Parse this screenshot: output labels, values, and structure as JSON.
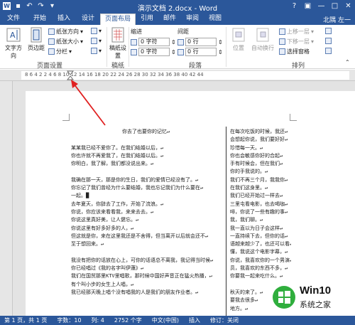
{
  "window": {
    "title": "演示文档 2.docx - Word",
    "user": "北隅 左一",
    "controls": [
      "?",
      "▣",
      "—",
      "□",
      "✕"
    ]
  },
  "tabs": [
    "文件",
    "开始",
    "插入",
    "设计",
    "页面布局",
    "引用",
    "邮件",
    "审阅",
    "视图"
  ],
  "active_tab": "页面布局",
  "ribbon": {
    "page_setup": {
      "label": "页面设置",
      "text_direction": "文字方向",
      "margins": "页边距",
      "orientation": "纸张方向",
      "size": "纸张大小",
      "columns": "分栏"
    },
    "manuscript": {
      "label": "稿纸",
      "settings": "稿纸设置"
    },
    "paragraph": {
      "label": "段落",
      "indent_label": "缩进",
      "spacing_label": "间距",
      "left_value": "0 字符",
      "right_value": "0 字符",
      "before_value": "0 行",
      "after_value": "0 行"
    },
    "arrange": {
      "label": "排列",
      "position": "位置",
      "wrap": "自动换行",
      "bring_forward": "上移一层",
      "send_backward": "下移一层",
      "selection_pane": "选择窗格"
    }
  },
  "ruler": {
    "ticks": "8  6  4  2     2  4  6  8  10  12  14  16  18  20  22  24  26  28  30  32  34  36  38  40  42  44"
  },
  "document": {
    "left_column": [
      "你去了也要你的记忆↵",
      "",
      "某某我已经不爱你了。在我们结婚以后，↵",
      "你也许就不再爱我了，在我们结婚以后。↵",
      "你明白，我了解，我们都没说出来。↵",
      "",
      "我确在那一天，那是你的生日，我们的爱情已经没有了。↵",
      "你忘记了我们曾经为什么要结婚，我也忘记我们为什么要在↵",
      "一起。█",
      "去年夏天，你辞去了工作，开始了流浪。↵",
      "你说，你应该来看看我，来来去去。↵",
      "你说这里真好美，让人健忘。↵",
      "你说这里有好多好多的人，↵",
      "但这就是你，来在这里我还是不舍得，但当离开以后就会还不↵",
      "至于想回来。↵",
      "",
      "我没有把你的话放在心上，可你的话语总不离我，我记得当时候↵",
      "你已经唱过《我的名字叫伊蓮》↵",
      "我们在国贸那里KTV里唱歌，那时候中国好声音正在猛火热播，↵",
      "有个叫小步的女生上人唱，↵",
      "我已经那天晚上唱个没有唱我的人是我们的朋友作业者。↵"
    ],
    "right_column": [
      "在每次吃饭的时候，我还↵",
      "会想起你说，我们要好好↵",
      "珍惜每一天。↵",
      "你也会敏感你好的合起↵",
      "手有时候会，但在我们↵",
      "你的手我说的。↵",
      "我们不再三个月，我我你↵",
      "在我们这身里。↵",
      "我们已经开始过一样去↵",
      "三里屯看电影，也去喝咖↵",
      "啡，你说了一些有趣的事↵",
      "我，我们聊。↵",
      "我一直以为日子会这样↵",
      "一直持续下去，但你的话↵",
      "语越来越少了，也还可以看↵",
      "懂，我说这个电影字幕，↵",
      "你说，我喜欢你的一个男演↵",
      "员，我喜欢的东西不多，↵",
      "你要我一起来吃什么。↵",
      "",
      "秋天的来了。↵",
      "要我去很多↵",
      "地方。↵"
    ]
  },
  "status": {
    "page": "第 1 页，共 1 页",
    "words": "字数：10",
    "col": "列: 4",
    "chars": "2752 个字",
    "lang": "中文(中国)",
    "mode": "插入",
    "macro": "修订：关闭"
  },
  "watermark": {
    "brand": "Win10",
    "sub": "系统之家"
  }
}
